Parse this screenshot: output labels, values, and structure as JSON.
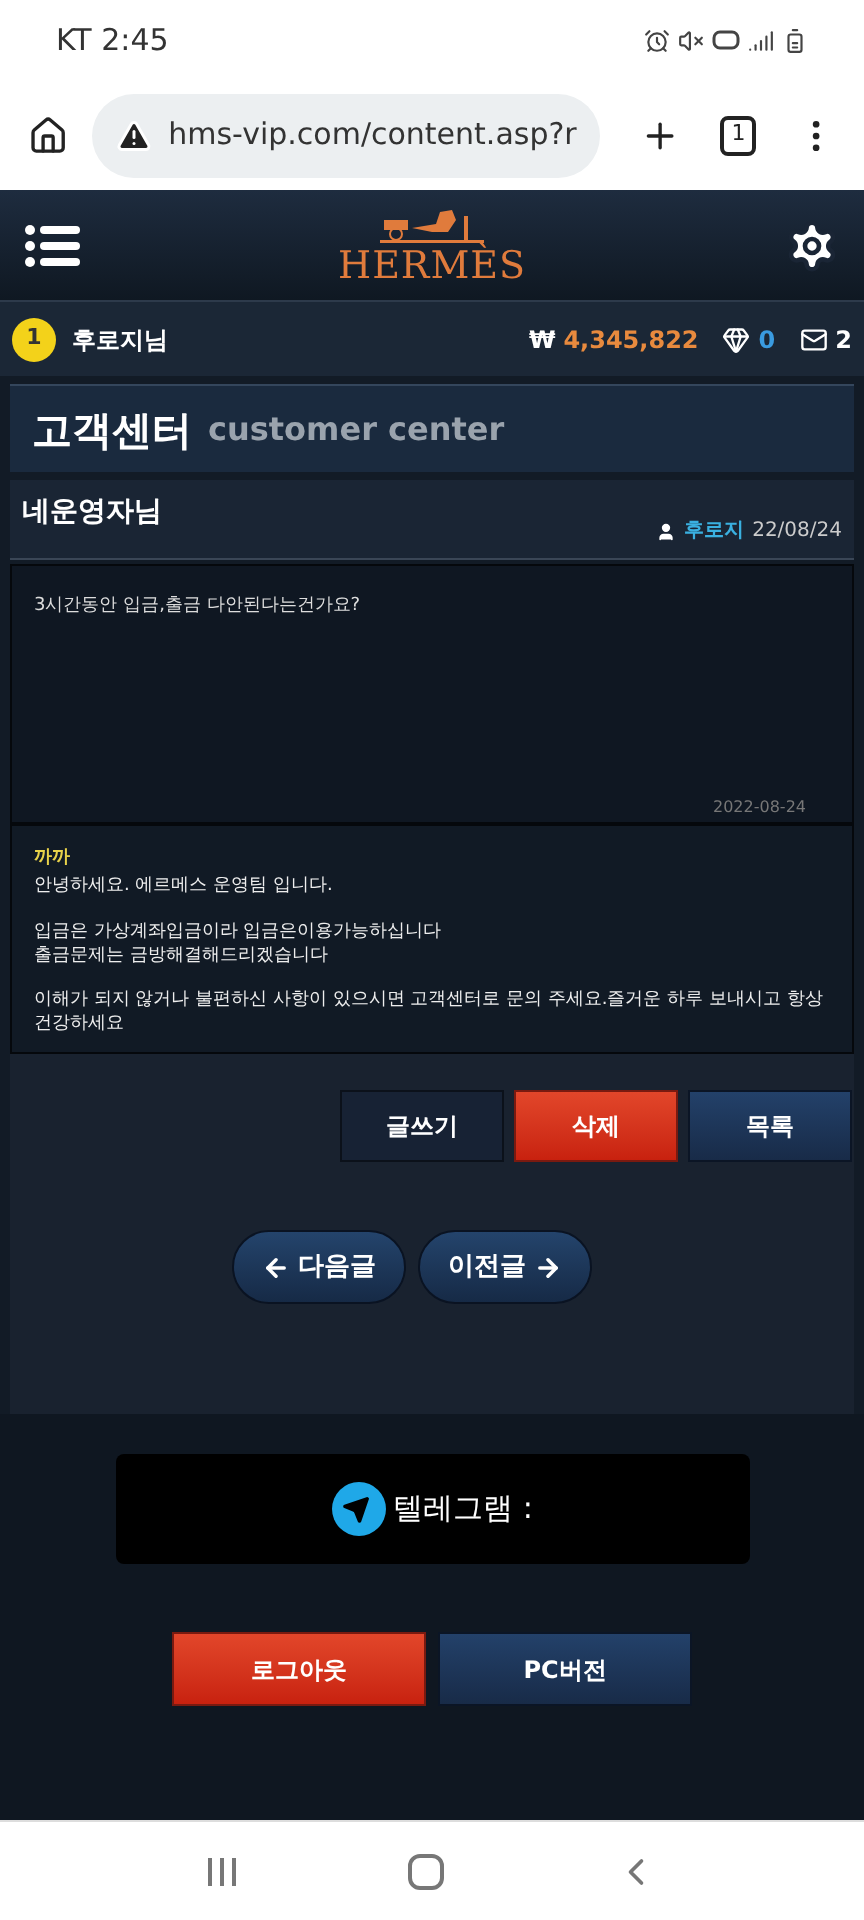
{
  "status_bar": {
    "carrier_time": "KT 2:45"
  },
  "browser": {
    "url": "hms-vip.com/content.asp?r",
    "tab_count": "1"
  },
  "header": {
    "logo": "HERMÈS"
  },
  "user_bar": {
    "level": "1",
    "name": "후로지님",
    "currency": "₩",
    "balance": "4,345,822",
    "points": "0",
    "messages": "2"
  },
  "page_title": {
    "korean": "고객센터",
    "english": "customer center"
  },
  "post": {
    "title": "네운영자님",
    "author": "후로지",
    "date": "22/08/24",
    "question": "3시간동안 입금,출금 다안된다는건가요?",
    "question_date": "2022-08-24",
    "answer": {
      "author": "까까",
      "paragraphs": [
        "안녕하세요. 에르메스 운영팀 입니다.",
        "입금은 가상계좌입금이라 입금은이용가능하십니다\n출금문제는 금방해결해드리겠습니다",
        "이해가 되지 않거나 불편하신 사항이 있으시면 고객센터로 문의 주세요.즐거운 하루 보내시고 항상 건강하세요"
      ]
    }
  },
  "actions": [
    {
      "label": "글쓰기",
      "kind": "dark"
    },
    {
      "label": "삭제",
      "kind": "red"
    },
    {
      "label": "목록",
      "kind": "blue"
    }
  ],
  "pager": [
    {
      "label": "다음글",
      "kind": "prev"
    },
    {
      "label": "이전글",
      "kind": "next"
    }
  ],
  "telegram": {
    "label": "텔레그램 :"
  },
  "bottom_buttons": [
    {
      "label": "로그아웃",
      "kind": "red"
    },
    {
      "label": "PC버전",
      "kind": "blue"
    }
  ]
}
